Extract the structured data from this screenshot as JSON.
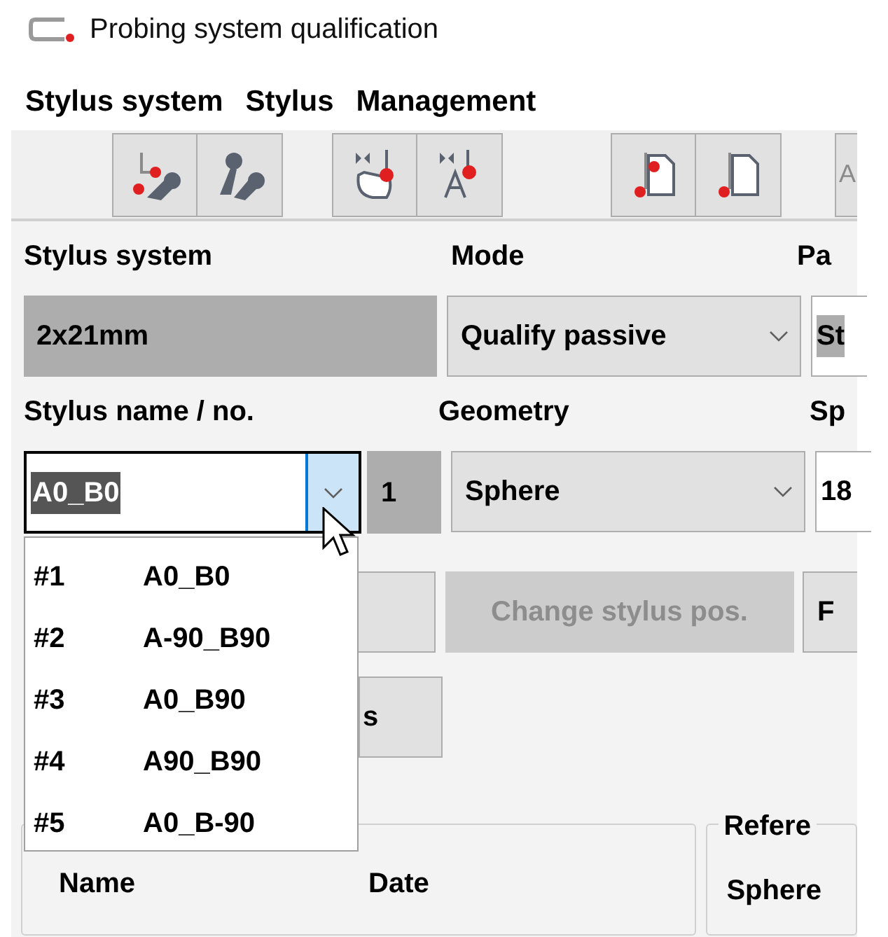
{
  "window": {
    "title": "Probing system qualification"
  },
  "menu": [
    {
      "label": "Stylus system"
    },
    {
      "label": "Stylus"
    },
    {
      "label": "Management"
    }
  ],
  "toolbar": {
    "cut_button_label": "A"
  },
  "form": {
    "row_1": [
      {
        "label": "Stylus system",
        "value": "2x21mm",
        "kind": "readonly"
      },
      {
        "label": "Mode",
        "value": "Qualify passive",
        "kind": "combo"
      },
      {
        "label": "Pa",
        "value": "St",
        "kind": "cut"
      }
    ],
    "row_2": [
      {
        "label": "Stylus name / no.",
        "value": "A0_B0",
        "number": "1",
        "kind": "editcombo",
        "expanded": true
      },
      {
        "label": "Geometry",
        "value": "Sphere",
        "kind": "combo"
      },
      {
        "label": "Sp",
        "value": "18",
        "kind": "cut"
      }
    ]
  },
  "stylus_list": [
    {
      "number": "#1",
      "name": "A0_B0",
      "selected": false
    },
    {
      "number": "#2",
      "name": "A-90_B90",
      "selected": false
    },
    {
      "number": "#3",
      "name": "A0_B90",
      "selected": false
    },
    {
      "number": "#4",
      "name": "A90_B90",
      "selected": false
    },
    {
      "number": "#5",
      "name": "A0_B-90",
      "selected": false
    }
  ],
  "buttons": [
    {
      "label": "Change stylus pos.",
      "disabled": true
    },
    {
      "label": "F",
      "disabled": false
    }
  ],
  "second_button": {
    "label": "s"
  },
  "groups": [
    {
      "columns": [
        "Name",
        "Date"
      ]
    },
    {
      "title": "Refere",
      "label": "Sphere"
    }
  ]
}
